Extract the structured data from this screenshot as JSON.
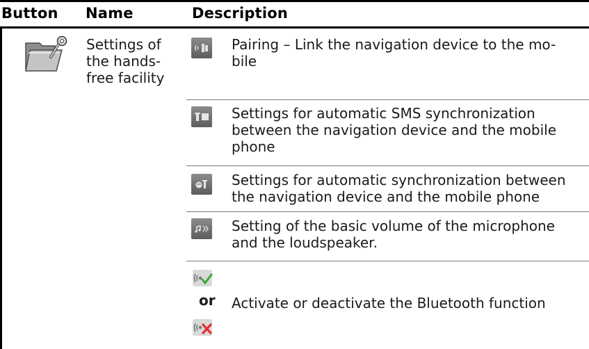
{
  "header": {
    "button": "Button",
    "name": "Name",
    "description": "Description"
  },
  "group": {
    "name": "Settings of the hands-free facility",
    "name_lines": [
      "Settings of",
      "the hands-",
      "free facility"
    ],
    "icon": "folder-settings-icon"
  },
  "rows": [
    {
      "icon": "phone-pairing-icon",
      "lines": [
        "Pairing – Link the navigation device to the mo-",
        "bile"
      ]
    },
    {
      "icon": "sms-sync-icon",
      "lines": [
        "Settings for automatic SMS synchronization",
        "between the navigation device and the mobile",
        "phone"
      ]
    },
    {
      "icon": "contacts-sync-icon",
      "lines": [
        "Settings for automatic synchronization between",
        "the navigation device and the mobile phone"
      ]
    },
    {
      "icon": "volume-icon",
      "lines": [
        "Setting of the basic volume of the microphone",
        "and the loudspeaker."
      ]
    },
    {
      "icon_on": "bluetooth-on-icon",
      "icon_off": "bluetooth-off-icon",
      "or_label": "or",
      "lines": [
        "Activate or deactivate the Bluetooth function"
      ]
    }
  ],
  "colors": {
    "rule": "#000000",
    "row_divider": "#7a7a7a",
    "icon_bg": "#6e6e6e",
    "check_green": "#3aa53a",
    "cross_red": "#e53030"
  }
}
